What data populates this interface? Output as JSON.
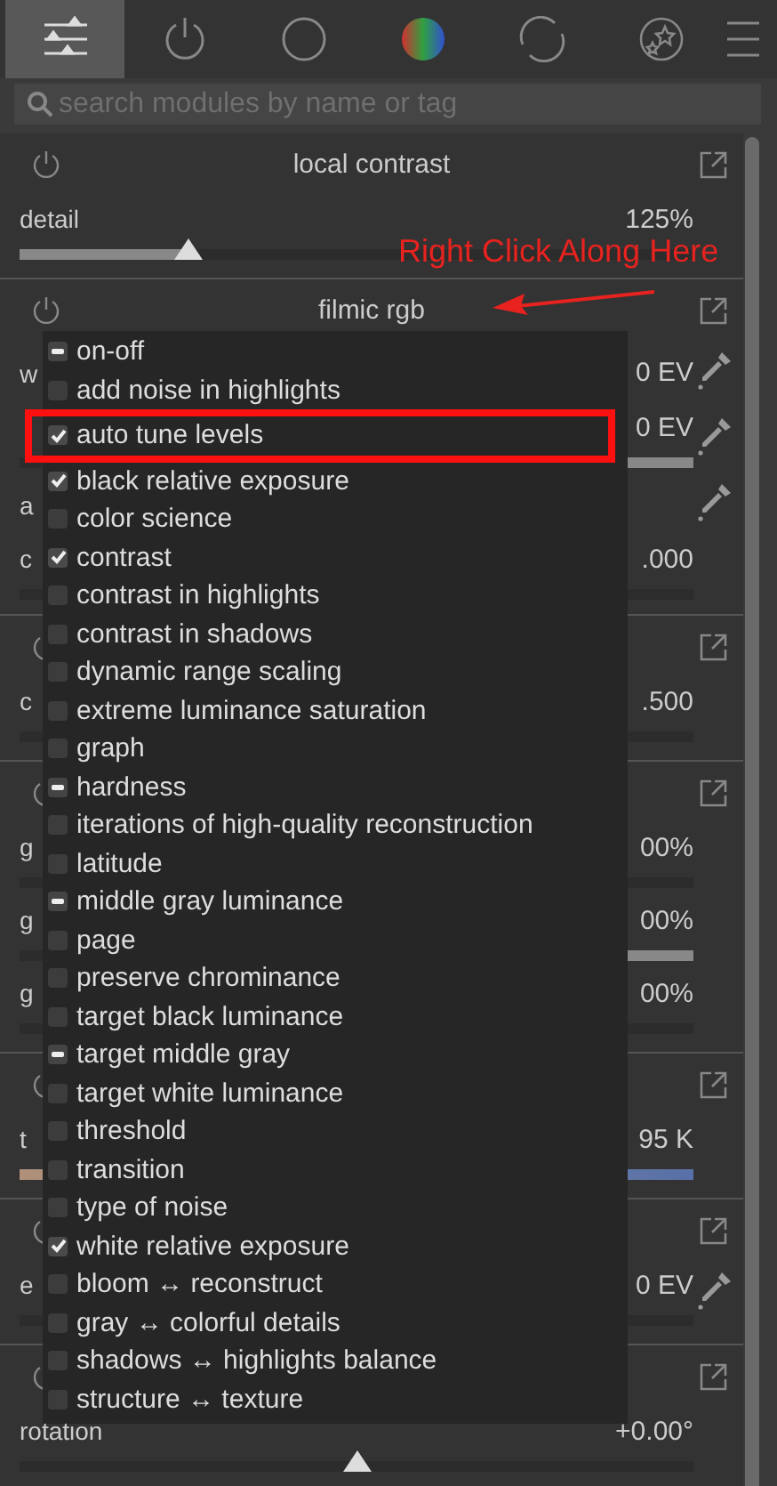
{
  "tabs": [
    {
      "kind": "sliders",
      "selected": true
    },
    {
      "kind": "power",
      "selected": false
    },
    {
      "kind": "circle",
      "selected": false
    },
    {
      "kind": "color",
      "selected": false
    },
    {
      "kind": "rotate",
      "selected": false
    },
    {
      "kind": "stars",
      "selected": false
    }
  ],
  "search": {
    "placeholder": "search modules by name or tag"
  },
  "modules": [
    {
      "name": "local contrast",
      "rows": [
        {
          "label": "detail",
          "value": "125%",
          "kind": "slider",
          "level": 0.25
        }
      ]
    },
    {
      "name": "filmic rgb",
      "rows": [
        {
          "label": "w",
          "value": "0 EV",
          "kind": "none",
          "picker": true
        },
        {
          "value": "0 EV",
          "kind": "track",
          "picker": true
        },
        {
          "label": "a",
          "kind": "none",
          "picker": true
        },
        {
          "label": "c",
          "value": ".000",
          "kind": "track"
        }
      ]
    },
    {
      "rows": [
        {
          "label": "c",
          "value": ".500",
          "kind": "track"
        }
      ]
    },
    {
      "rows": [
        {
          "label": "g",
          "value": "00%",
          "kind": "track"
        },
        {
          "label": "g",
          "value": "00%",
          "kind": "track"
        },
        {
          "label": "g",
          "value": "00%",
          "kind": "track"
        }
      ]
    },
    {
      "rows": [
        {
          "label": "t",
          "value": "95 K",
          "kind": "gradient"
        }
      ]
    },
    {
      "rows": [
        {
          "label": "e",
          "value": "0 EV",
          "kind": "track",
          "picker": true
        }
      ]
    },
    {
      "rows": [
        {
          "label": "rotation",
          "value": "+0.00°",
          "kind": "thumb",
          "level": 0.5
        }
      ]
    }
  ],
  "annotation": {
    "text": "Right Click Along Here"
  },
  "popup": {
    "items": [
      {
        "label": "on-off",
        "checked": false,
        "mixed": true,
        "highlighted": false
      },
      {
        "label": "add noise in highlights",
        "checked": false,
        "mixed": false,
        "highlighted": false
      },
      {
        "label": "auto tune levels",
        "checked": true,
        "mixed": false,
        "highlighted": true
      },
      {
        "label": "black relative exposure",
        "checked": true,
        "mixed": false,
        "highlighted": false
      },
      {
        "label": "color science",
        "checked": false,
        "mixed": false,
        "highlighted": false
      },
      {
        "label": "contrast",
        "checked": true,
        "mixed": false,
        "highlighted": false
      },
      {
        "label": "contrast in highlights",
        "checked": false,
        "mixed": false,
        "highlighted": false
      },
      {
        "label": "contrast in shadows",
        "checked": false,
        "mixed": false,
        "highlighted": false
      },
      {
        "label": "dynamic range scaling",
        "checked": false,
        "mixed": false,
        "highlighted": false
      },
      {
        "label": "extreme luminance saturation",
        "checked": false,
        "mixed": false,
        "highlighted": false
      },
      {
        "label": "graph",
        "checked": false,
        "mixed": false,
        "highlighted": false
      },
      {
        "label": "hardness",
        "checked": false,
        "mixed": true,
        "highlighted": false
      },
      {
        "label": "iterations of high-quality reconstruction",
        "checked": false,
        "mixed": false,
        "highlighted": false
      },
      {
        "label": "latitude",
        "checked": false,
        "mixed": false,
        "highlighted": false
      },
      {
        "label": "middle gray luminance",
        "checked": false,
        "mixed": true,
        "highlighted": false
      },
      {
        "label": "page",
        "checked": false,
        "mixed": false,
        "highlighted": false
      },
      {
        "label": "preserve chrominance",
        "checked": false,
        "mixed": false,
        "highlighted": false
      },
      {
        "label": "target black luminance",
        "checked": false,
        "mixed": false,
        "highlighted": false
      },
      {
        "label": "target middle gray",
        "checked": false,
        "mixed": true,
        "highlighted": false
      },
      {
        "label": "target white luminance",
        "checked": false,
        "mixed": false,
        "highlighted": false
      },
      {
        "label": "threshold",
        "checked": false,
        "mixed": false,
        "highlighted": false
      },
      {
        "label": "transition",
        "checked": false,
        "mixed": false,
        "highlighted": false
      },
      {
        "label": "type of noise",
        "checked": false,
        "mixed": false,
        "highlighted": false
      },
      {
        "label": "white relative exposure",
        "checked": true,
        "mixed": false,
        "highlighted": false
      },
      {
        "label": "bloom ↔ reconstruct",
        "checked": false,
        "mixed": false,
        "highlighted": false
      },
      {
        "label": "gray ↔ colorful details",
        "checked": false,
        "mixed": false,
        "highlighted": false
      },
      {
        "label": "shadows ↔ highlights balance",
        "checked": false,
        "mixed": false,
        "highlighted": false
      },
      {
        "label": "structure ↔ texture",
        "checked": false,
        "mixed": false,
        "highlighted": false
      }
    ]
  }
}
